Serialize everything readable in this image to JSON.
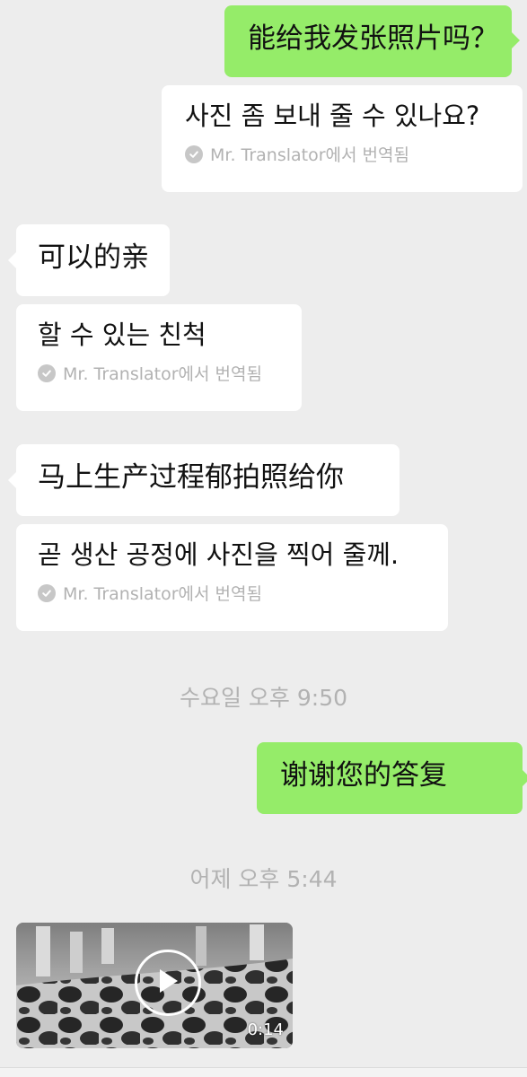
{
  "messages": {
    "m1": {
      "text": "能给我发张照片吗？"
    },
    "t1": {
      "text": "사진 좀 보내 줄 수 있나요?",
      "attribution": "Mr. Translator에서 번역됨"
    },
    "m2": {
      "text": "可以的亲"
    },
    "t2": {
      "text": "할 수 있는 친척",
      "attribution": "Mr. Translator에서 번역됨"
    },
    "m3": {
      "text": "马上生产过程郁拍照给你"
    },
    "t3": {
      "text": "곧 생산 공정에 사진을 찍어 줄께.",
      "attribution": "Mr. Translator에서 번역됨"
    },
    "ts1": "수요일 오후 9:50",
    "m4": {
      "text": "谢谢您的答复"
    },
    "ts2": "어제 오후 5:44",
    "video": {
      "duration": "0:14"
    }
  },
  "colors": {
    "background": "#ededed",
    "outgoing_bubble": "#95ec69",
    "incoming_bubble": "#ffffff",
    "meta_text": "#b2b2b2"
  },
  "icons": {
    "translation_check": "check-circle-icon",
    "video_play": "play-icon"
  }
}
